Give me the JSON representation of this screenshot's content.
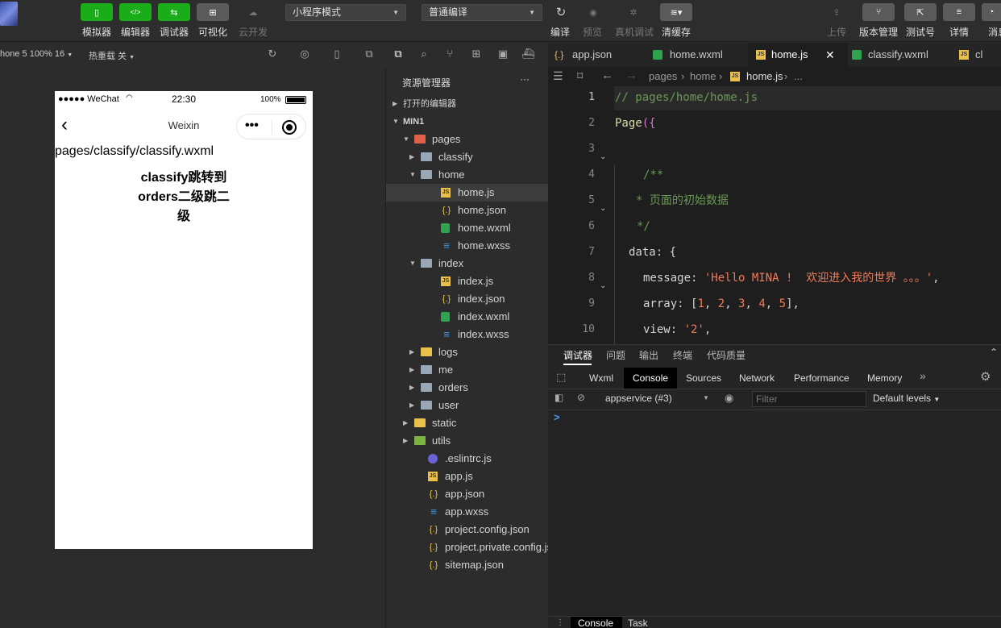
{
  "toolbar": {
    "simulator": "模拟器",
    "editor": "编辑器",
    "debugger": "调试器",
    "visual": "可视化",
    "cloud": "云开发",
    "mode": "小程序模式",
    "compile_mode": "普通编译",
    "compile": "编译",
    "preview": "预览",
    "real_debug": "真机调试",
    "clear_cache": "清缓存",
    "upload": "上传",
    "version": "版本管理",
    "test_account": "测试号",
    "details": "详情",
    "messages": "消息"
  },
  "subbar": {
    "device": "hone 5 100% 16",
    "hot_reload": "热重载 关"
  },
  "phone": {
    "carrier": "●●●●● WeChat",
    "time": "22:30",
    "battery": "100%",
    "nav_title": "Weixin",
    "path_text": "pages/classify/classify.wxml",
    "heading_line1": "classify跳转到",
    "heading_line2": "orders二级跳二",
    "heading_line3": "级"
  },
  "explorer": {
    "title": "资源管理器",
    "more": "···",
    "open_editors": "打开的编辑器",
    "project": "MIN1",
    "items": [
      {
        "name": "pages"
      },
      {
        "name": "classify"
      },
      {
        "name": "home"
      },
      {
        "name": "home.js"
      },
      {
        "name": "home.json"
      },
      {
        "name": "home.wxml"
      },
      {
        "name": "home.wxss"
      },
      {
        "name": "index"
      },
      {
        "name": "index.js"
      },
      {
        "name": "index.json"
      },
      {
        "name": "index.wxml"
      },
      {
        "name": "index.wxss"
      },
      {
        "name": "logs"
      },
      {
        "name": "me"
      },
      {
        "name": "orders"
      },
      {
        "name": "user"
      },
      {
        "name": "static"
      },
      {
        "name": "utils"
      },
      {
        "name": ".eslintrc.js"
      },
      {
        "name": "app.js"
      },
      {
        "name": "app.json"
      },
      {
        "name": "app.wxss"
      },
      {
        "name": "project.config.json"
      },
      {
        "name": "project.private.config.js..."
      },
      {
        "name": "sitemap.json"
      }
    ]
  },
  "editor": {
    "tabs": [
      {
        "name": "app.json"
      },
      {
        "name": "home.wxml"
      },
      {
        "name": "home.js"
      },
      {
        "name": "classify.wxml"
      },
      {
        "name": "cl"
      }
    ],
    "breadcrumb": {
      "p1": "pages",
      "p2": "home",
      "p3": "home.js",
      "p4": "..."
    },
    "line_numbers": [
      "1",
      "2",
      "3",
      "4",
      "5",
      "6",
      "7",
      "8",
      "9",
      "10"
    ],
    "code": {
      "l1": "// pages/home/home.js",
      "l2a": "Page",
      "l2b": "({",
      "l4": "/**",
      "l5": "* 页面的初始数据",
      "l6": "*/",
      "l7a": "data",
      "l7b": ": {",
      "l8a": "message",
      "l8b": ": ",
      "l8c": "'Hello MINA !  欢迎进入我的世界 。。。'",
      "l8d": ",",
      "l9a": "array",
      "l9b": ": [",
      "l9n1": "1",
      "l9n2": "2",
      "l9n3": "3",
      "l9n4": "4",
      "l9n5": "5",
      "l9c": "],",
      "l10a": "view",
      "l10b": ": ",
      "l10c": "'2'",
      "l10d": ","
    }
  },
  "devtools": {
    "top_tabs": [
      "调试器",
      "问题",
      "输出",
      "终端",
      "代码质量"
    ],
    "panels": [
      "Wxml",
      "Console",
      "Sources",
      "Network",
      "Performance",
      "Memory"
    ],
    "context": "appservice (#3)",
    "filter_placeholder": "Filter",
    "levels": "Default levels",
    "prompt": ">",
    "bottom_tabs": [
      "Console",
      "Task"
    ]
  },
  "colors": {
    "accent_green": "#1aad19",
    "comment": "#6a9955",
    "string": "#ce9178",
    "number": "#e08060",
    "keyword_yellow": "#dcdcaa"
  }
}
